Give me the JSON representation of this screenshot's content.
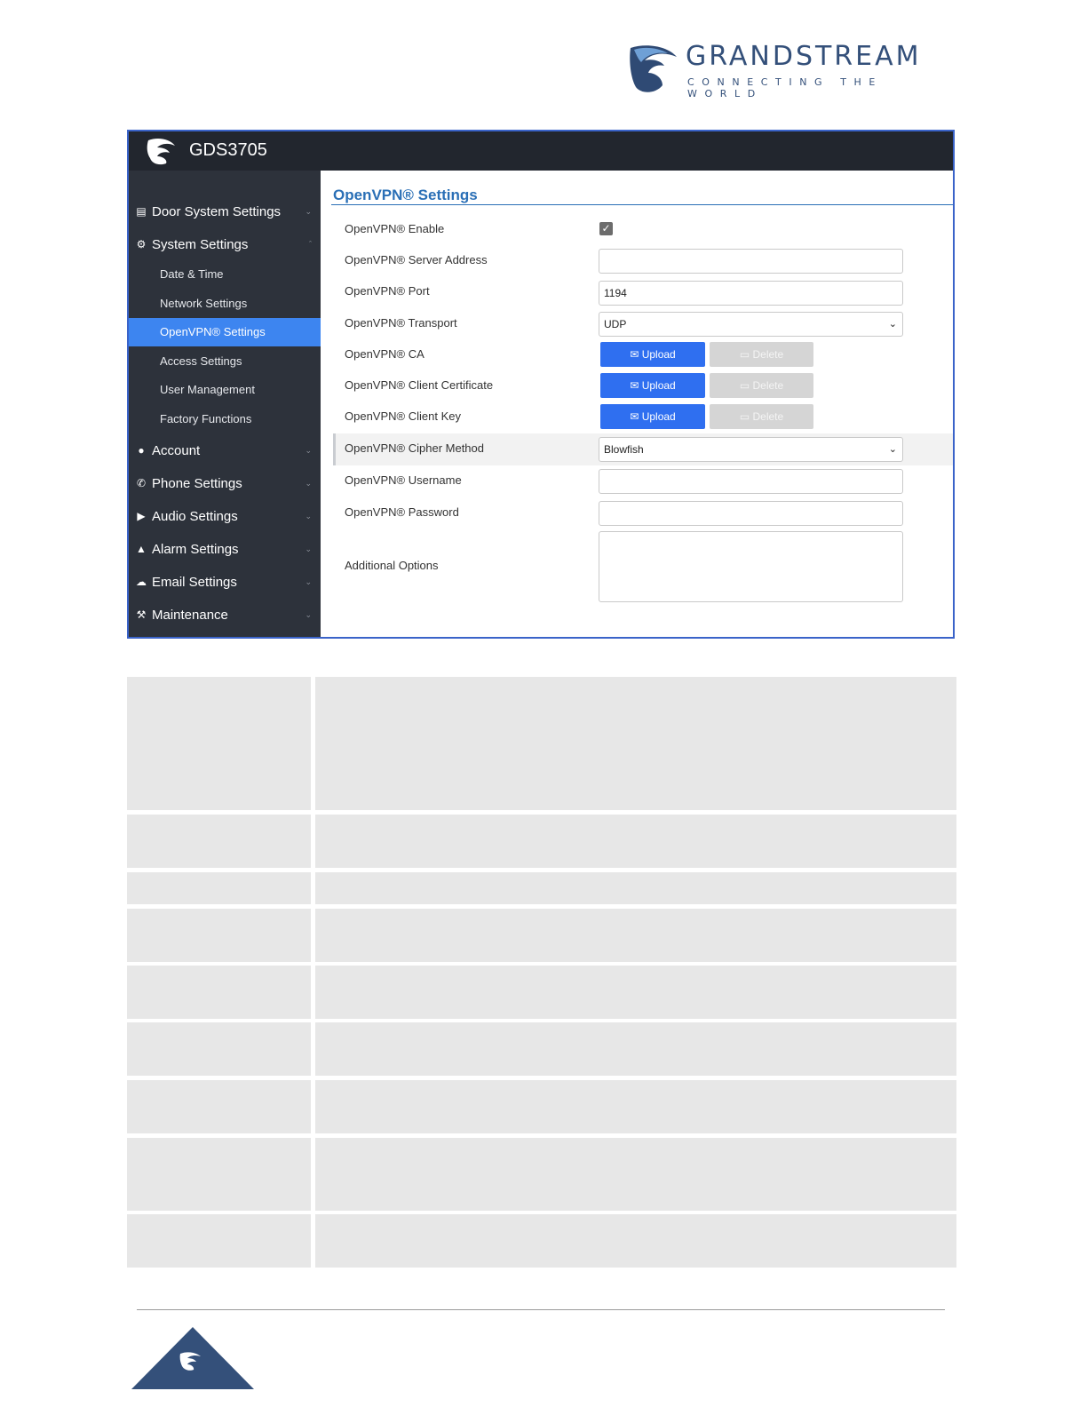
{
  "brand": {
    "name": "GRANDSTREAM",
    "tagline": "CONNECTING THE WORLD"
  },
  "app": {
    "title": "GDS3705"
  },
  "sidebar": {
    "items": [
      {
        "label": "Door System Settings",
        "icon": "card-icon",
        "expanded": false
      },
      {
        "label": "System Settings",
        "icon": "gear-icon",
        "expanded": true
      },
      {
        "label": "Account",
        "icon": "user-icon",
        "expanded": false
      },
      {
        "label": "Phone Settings",
        "icon": "phone-icon",
        "expanded": false
      },
      {
        "label": "Audio Settings",
        "icon": "speaker-icon",
        "expanded": false
      },
      {
        "label": "Alarm Settings",
        "icon": "bell-icon",
        "expanded": false
      },
      {
        "label": "Email Settings",
        "icon": "cloud-icon",
        "expanded": false
      },
      {
        "label": "Maintenance",
        "icon": "wrench-icon",
        "expanded": false
      }
    ],
    "sub_items": [
      {
        "label": "Date & Time"
      },
      {
        "label": "Network Settings"
      },
      {
        "label": "OpenVPN® Settings",
        "active": true
      },
      {
        "label": "Access Settings"
      },
      {
        "label": "User Management"
      },
      {
        "label": "Factory Functions"
      }
    ]
  },
  "content": {
    "title": "OpenVPN® Settings",
    "fields": {
      "enable": {
        "label": "OpenVPN® Enable",
        "checked": true
      },
      "server": {
        "label": "OpenVPN® Server Address",
        "value": ""
      },
      "port": {
        "label": "OpenVPN® Port",
        "value": "1194"
      },
      "transport": {
        "label": "OpenVPN® Transport",
        "value": "UDP"
      },
      "ca": {
        "label": "OpenVPN® CA"
      },
      "client_cert": {
        "label": "OpenVPN® Client Certificate"
      },
      "client_key": {
        "label": "OpenVPN® Client Key"
      },
      "cipher": {
        "label": "OpenVPN® Cipher Method",
        "value": "Blowfish"
      },
      "username": {
        "label": "OpenVPN® Username",
        "value": ""
      },
      "password": {
        "label": "OpenVPN® Password",
        "value": ""
      },
      "additional": {
        "label": "Additional Options",
        "value": ""
      }
    },
    "upload_label": "Upload",
    "delete_label": "Delete"
  },
  "colors": {
    "accent": "#3d85f0",
    "upload_button": "#2f6ff0",
    "sidebar_bg": "#2d323b",
    "topbar_bg": "#22262e",
    "title_blue": "#2a6fb6",
    "brand_blue": "#34507a"
  }
}
